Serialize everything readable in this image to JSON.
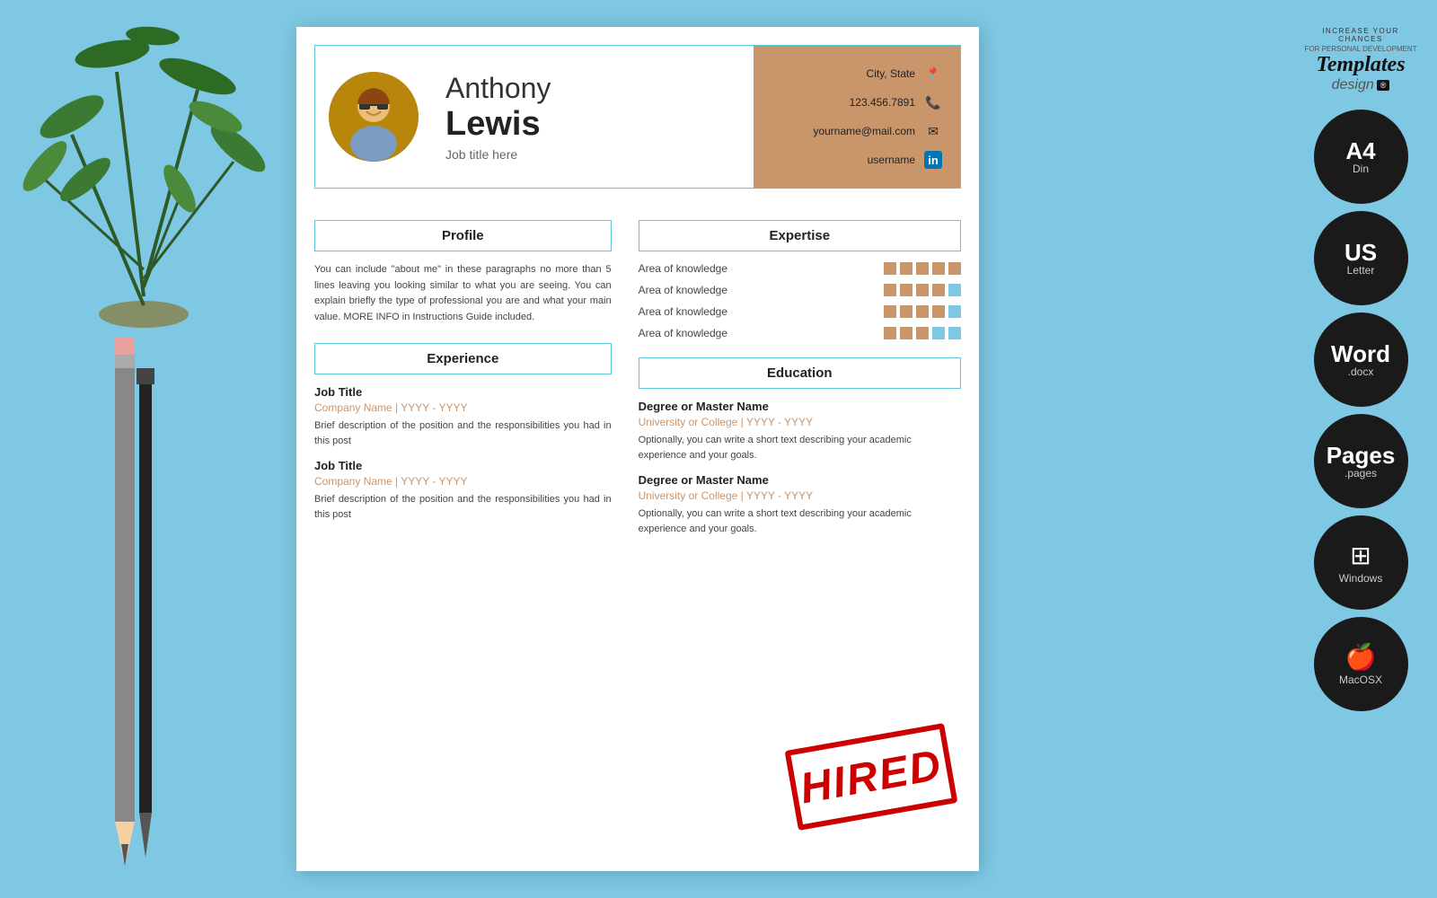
{
  "background_color": "#7ec8e3",
  "resume": {
    "header": {
      "first_name": "Anthony",
      "last_name": "Lewis",
      "job_title": "Job title here",
      "contact": {
        "city_state": "City, State",
        "phone": "123.456.7891",
        "email": "yourname@mail.com",
        "linkedin": "username"
      }
    },
    "profile": {
      "section_label": "Profile",
      "text": "You can include \"about me\" in these paragraphs no more than 5 lines leaving you looking similar to what you are seeing. You can explain briefly the type of professional you are and what your main value. MORE INFO in Instructions Guide included."
    },
    "expertise": {
      "section_label": "Expertise",
      "items": [
        {
          "label": "Area of knowledge",
          "filled": 5,
          "total": 5
        },
        {
          "label": "Area of knowledge",
          "filled": 4,
          "total": 5
        },
        {
          "label": "Area of knowledge",
          "filled": 4,
          "total": 5
        },
        {
          "label": "Area of knowledge",
          "filled": 3,
          "total": 5
        }
      ]
    },
    "experience": {
      "section_label": "Experience",
      "jobs": [
        {
          "title": "Job Title",
          "company": "Company Name | YYYY - YYYY",
          "description": "Brief description of the position and the responsibilities you had in this post"
        },
        {
          "title": "Job Title",
          "company": "Company Name | YYYY - YYYY",
          "description": "Brief description of the position and the responsibilities you had in this post"
        }
      ]
    },
    "education": {
      "section_label": "Education",
      "items": [
        {
          "degree": "Degree or Master Name",
          "university": "University or College | YYYY - YYYY",
          "description": "Optionally, you can write a short text describing your academic experience and your goals."
        },
        {
          "degree": "Degree or Master Name",
          "university": "University or College | YYYY - YYYY",
          "description": "Optionally, you can write a short text describing your academic experience and your goals."
        }
      ]
    }
  },
  "sidebar": {
    "brand": {
      "templates_text": "Templates",
      "design_text": "design",
      "tagline": "INCREASE YOUR CHANCES"
    },
    "badges": [
      {
        "main": "A4",
        "sub": "Din"
      },
      {
        "main": "US",
        "sub": "Letter"
      },
      {
        "main": "Word",
        "sub": ".docx"
      },
      {
        "main": "Pages",
        "sub": ".pages"
      },
      {
        "main": "Windows",
        "sub": ""
      },
      {
        "main": "",
        "sub": "MacOSX"
      }
    ]
  },
  "stamp": {
    "text": "HIRED"
  },
  "icons": {
    "location": "📍",
    "phone": "📞",
    "email": "✉",
    "linkedin": "in",
    "windows_logo": "⊞",
    "apple_logo": ""
  }
}
